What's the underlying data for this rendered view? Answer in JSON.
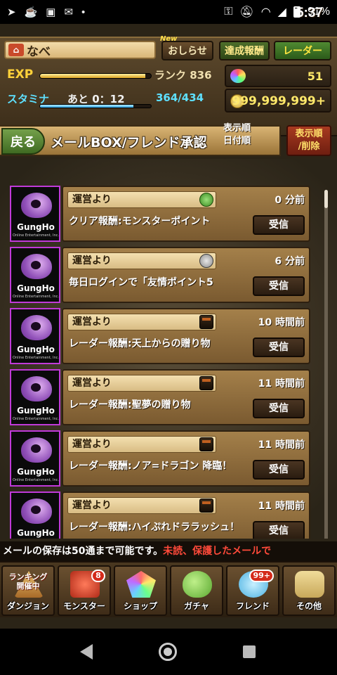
{
  "status_bar": {
    "time": "5:37",
    "battery": "91%",
    "notification_icons": [
      "navigation-icon",
      "game-icon",
      "lock-icon",
      "mail-icon",
      "dot-icon"
    ]
  },
  "header": {
    "player_name": "なべ",
    "news_badge": "New",
    "news_label": "おしらせ",
    "achievements_label": "達成報酬",
    "radar_label": "レーダー"
  },
  "stats": {
    "exp_label": "EXP",
    "exp_fill": 0.95,
    "rank": "ランク 836",
    "stamina_label": "スタミナ",
    "stamina_after": "あと 0：12",
    "stamina_value": "364/434",
    "stamina_fill": 0.84,
    "magic_stones": "51",
    "coins": "999,999,999+"
  },
  "title_row": {
    "back_label": "戻る",
    "title": "メールBOX/フレンド承認",
    "sort_label_1": "表示順",
    "sort_label_2": "日付順",
    "sort_button_1": "表示順",
    "sort_button_2": "/削除"
  },
  "mails": [
    {
      "sender": "運営より",
      "icon": "monster-point-icon",
      "time": "0 分前",
      "message": "クリア報酬:モンスターポイント",
      "receive": "受信"
    },
    {
      "sender": "運営より",
      "icon": "friend-point-icon",
      "time": "6 分前",
      "message": "毎日ログインで「友情ポイント5",
      "receive": "受信"
    },
    {
      "sender": "運営より",
      "icon": "treasure-chest-icon",
      "time": "10 時間前",
      "message": "レーダー報酬:天上からの贈り物",
      "receive": "受信"
    },
    {
      "sender": "運営より",
      "icon": "treasure-chest-icon",
      "time": "11 時間前",
      "message": "レーダー報酬:聖夢の贈り物",
      "receive": "受信"
    },
    {
      "sender": "運営より",
      "icon": "treasure-chest-icon",
      "time": "11 時間前",
      "message": "レーダー報酬:ノア=ドラゴン 降臨！",
      "receive": "受信"
    },
    {
      "sender": "運営より",
      "icon": "treasure-chest-icon",
      "time": "11 時間前",
      "message": "レーダー報酬:ハイぷれドララッシュ！",
      "receive": "受信"
    }
  ],
  "avatar": {
    "brand": "GungHo",
    "sub": "Online Entertainment, Inc."
  },
  "notice": {
    "text": "メールの保存は50通まで可能です。",
    "warning": "未読、保護したメールで"
  },
  "nav": {
    "dungeon_label": "ダンジョン",
    "dungeon_tag_1": "ランキング",
    "dungeon_tag_2": "開催中",
    "monster_label": "モンスター",
    "monster_badge": "8",
    "shop_label": "ショップ",
    "gacha_label": "ガチャ",
    "friend_label": "フレンド",
    "friend_badge": "99+",
    "other_label": "その他"
  }
}
